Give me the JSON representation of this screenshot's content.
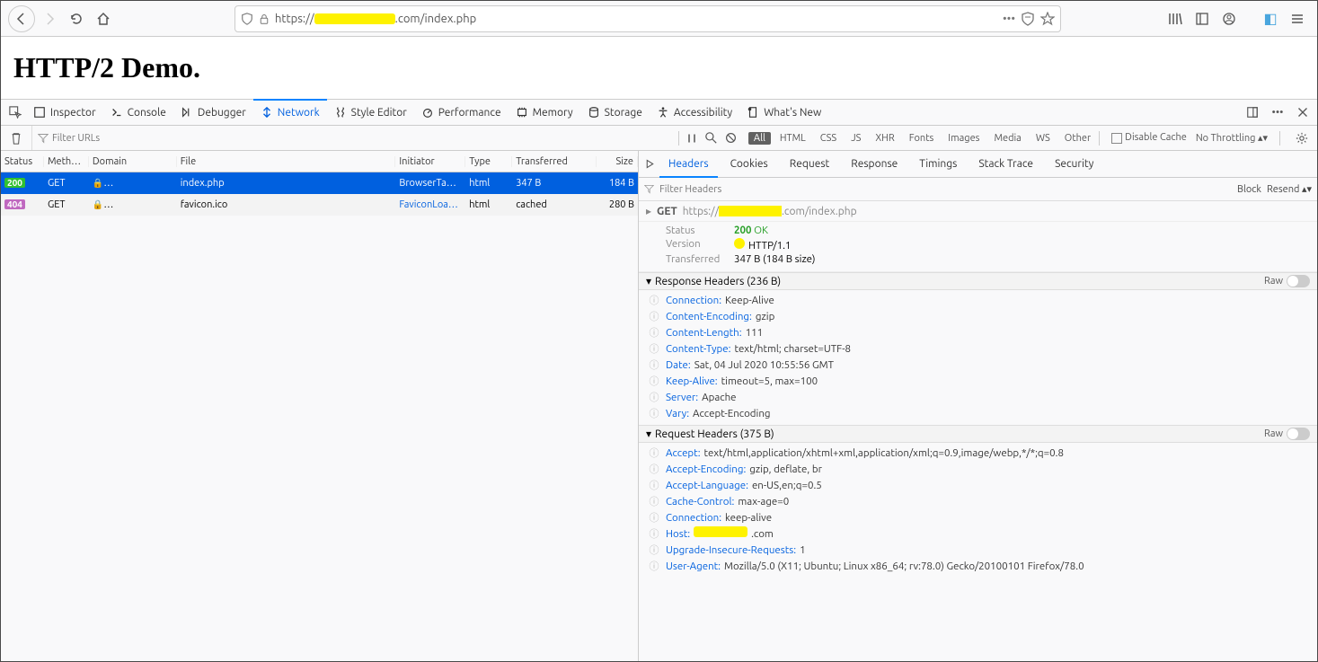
{
  "url": {
    "prefix": "https://",
    "suffix": ".com/index.php"
  },
  "pageTitle": "HTTP/2 Demo.",
  "devtoolsTabs": [
    "Inspector",
    "Console",
    "Debugger",
    "Network",
    "Style Editor",
    "Performance",
    "Memory",
    "Storage",
    "Accessibility",
    "What's New"
  ],
  "devtoolsActive": "Network",
  "filterURLsPlaceholder": "Filter URLs",
  "filterPills": [
    "All",
    "HTML",
    "CSS",
    "JS",
    "XHR",
    "Fonts",
    "Images",
    "Media",
    "WS",
    "Other"
  ],
  "filterActive": "All",
  "disableCache": "Disable Cache",
  "throttling": "No Throttling",
  "cols": {
    "status": "Status",
    "method": "Meth…",
    "domain": "Domain",
    "file": "File",
    "initiator": "Initiator",
    "type": "Type",
    "transferred": "Transferred",
    "size": "Size"
  },
  "rows": [
    {
      "status": "200",
      "statusClass": "s200",
      "method": "GET",
      "file": "index.php",
      "initiator": "BrowserTa…",
      "type": "html",
      "transferred": "347 B",
      "size": "184 B",
      "selected": true
    },
    {
      "status": "404",
      "statusClass": "s404",
      "method": "GET",
      "file": "favicon.ico",
      "initiator": "FaviconLoa…",
      "type": "html",
      "transferred": "cached",
      "size": "280 B",
      "selected": false
    }
  ],
  "detailTabs": [
    "Headers",
    "Cookies",
    "Request",
    "Response",
    "Timings",
    "Stack Trace",
    "Security"
  ],
  "detailActive": "Headers",
  "filterHeadersPlaceholder": "Filter Headers",
  "blockLabel": "Block",
  "resendLabel": "Resend",
  "reqLine": {
    "method": "GET",
    "prefix": "https://",
    "suffix": ".com/index.php"
  },
  "summary": {
    "status": {
      "code": "200",
      "text": "OK",
      "label": "Status"
    },
    "version": {
      "label": "Version",
      "value": "HTTP/1.1"
    },
    "transferred": {
      "label": "Transferred",
      "value": "347 B (184 B size)"
    }
  },
  "respHead": "Response Headers (236 B)",
  "reqHead": "Request Headers (375 B)",
  "rawLabel": "Raw",
  "respHeaders": [
    {
      "k": "Connection:",
      "v": "Keep-Alive"
    },
    {
      "k": "Content-Encoding:",
      "v": "gzip"
    },
    {
      "k": "Content-Length:",
      "v": "111"
    },
    {
      "k": "Content-Type:",
      "v": "text/html; charset=UTF-8"
    },
    {
      "k": "Date:",
      "v": "Sat, 04 Jul 2020 10:55:56 GMT"
    },
    {
      "k": "Keep-Alive:",
      "v": "timeout=5, max=100"
    },
    {
      "k": "Server:",
      "v": "Apache"
    },
    {
      "k": "Vary:",
      "v": "Accept-Encoding"
    }
  ],
  "reqHeaders": [
    {
      "k": "Accept:",
      "v": "text/html,application/xhtml+xml,application/xml;q=0.9,image/webp,*/*;q=0.8"
    },
    {
      "k": "Accept-Encoding:",
      "v": "gzip, deflate, br"
    },
    {
      "k": "Accept-Language:",
      "v": "en-US,en;q=0.5"
    },
    {
      "k": "Cache-Control:",
      "v": "max-age=0"
    },
    {
      "k": "Connection:",
      "v": "keep-alive"
    },
    {
      "k": "Host:",
      "v": ".com",
      "redact": true
    },
    {
      "k": "Upgrade-Insecure-Requests:",
      "v": "1"
    },
    {
      "k": "User-Agent:",
      "v": "Mozilla/5.0 (X11; Ubuntu; Linux x86_64; rv:78.0) Gecko/20100101 Firefox/78.0"
    }
  ]
}
